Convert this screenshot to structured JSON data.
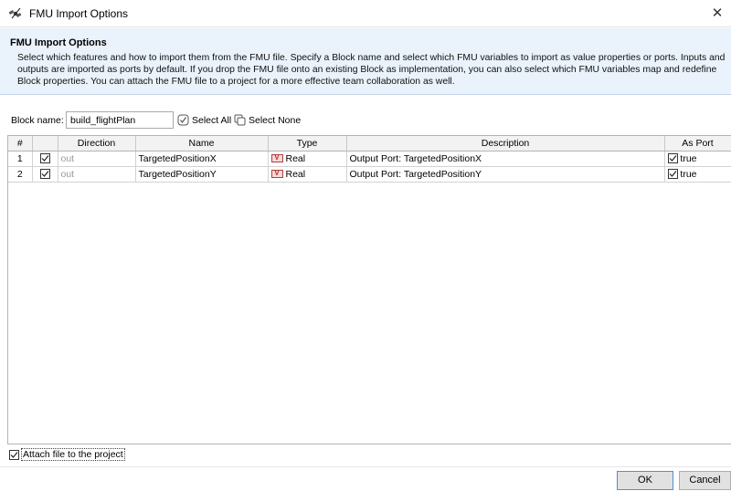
{
  "window": {
    "title": "FMU Import Options",
    "app_icon": "cameo-satellite-icon",
    "close_glyph": "✕"
  },
  "info": {
    "heading": "FMU Import Options",
    "description": "Select which features and how to import them from the FMU file. Specify a Block name and select which FMU variables to import as value properties or ports. Inputs and outputs are imported as ports by default. If you drop the FMU file onto an existing Block as implementation, you can also select which FMU variables map and redefine Block properties. You can attach the FMU file to a project for a more effective team collaboration as well."
  },
  "toolbar": {
    "block_name_label": "Block name:",
    "block_name_value": "build_flightPlan",
    "select_all_label": "Select All",
    "select_none_label": "Select None"
  },
  "table": {
    "columns": [
      "#",
      "",
      "Direction",
      "Name",
      "Type",
      "Description",
      "As Port"
    ],
    "rows": [
      {
        "num": "1",
        "checked": true,
        "direction": "out",
        "name": "TargetedPositionX",
        "type_badge": "V",
        "type": "Real",
        "description": "Output Port: TargetedPositionX",
        "as_port_checked": true,
        "as_port": "true"
      },
      {
        "num": "2",
        "checked": true,
        "direction": "out",
        "name": "TargetedPositionY",
        "type_badge": "V",
        "type": "Real",
        "description": "Output Port: TargetedPositionY",
        "as_port_checked": true,
        "as_port": "true"
      }
    ]
  },
  "footer": {
    "attach_checked": true,
    "attach_label": "Attach file to the project",
    "ok_label": "OK",
    "cancel_label": "Cancel"
  },
  "colors": {
    "info_background": "#eaf2fb",
    "accent_border": "#4a90d8"
  }
}
